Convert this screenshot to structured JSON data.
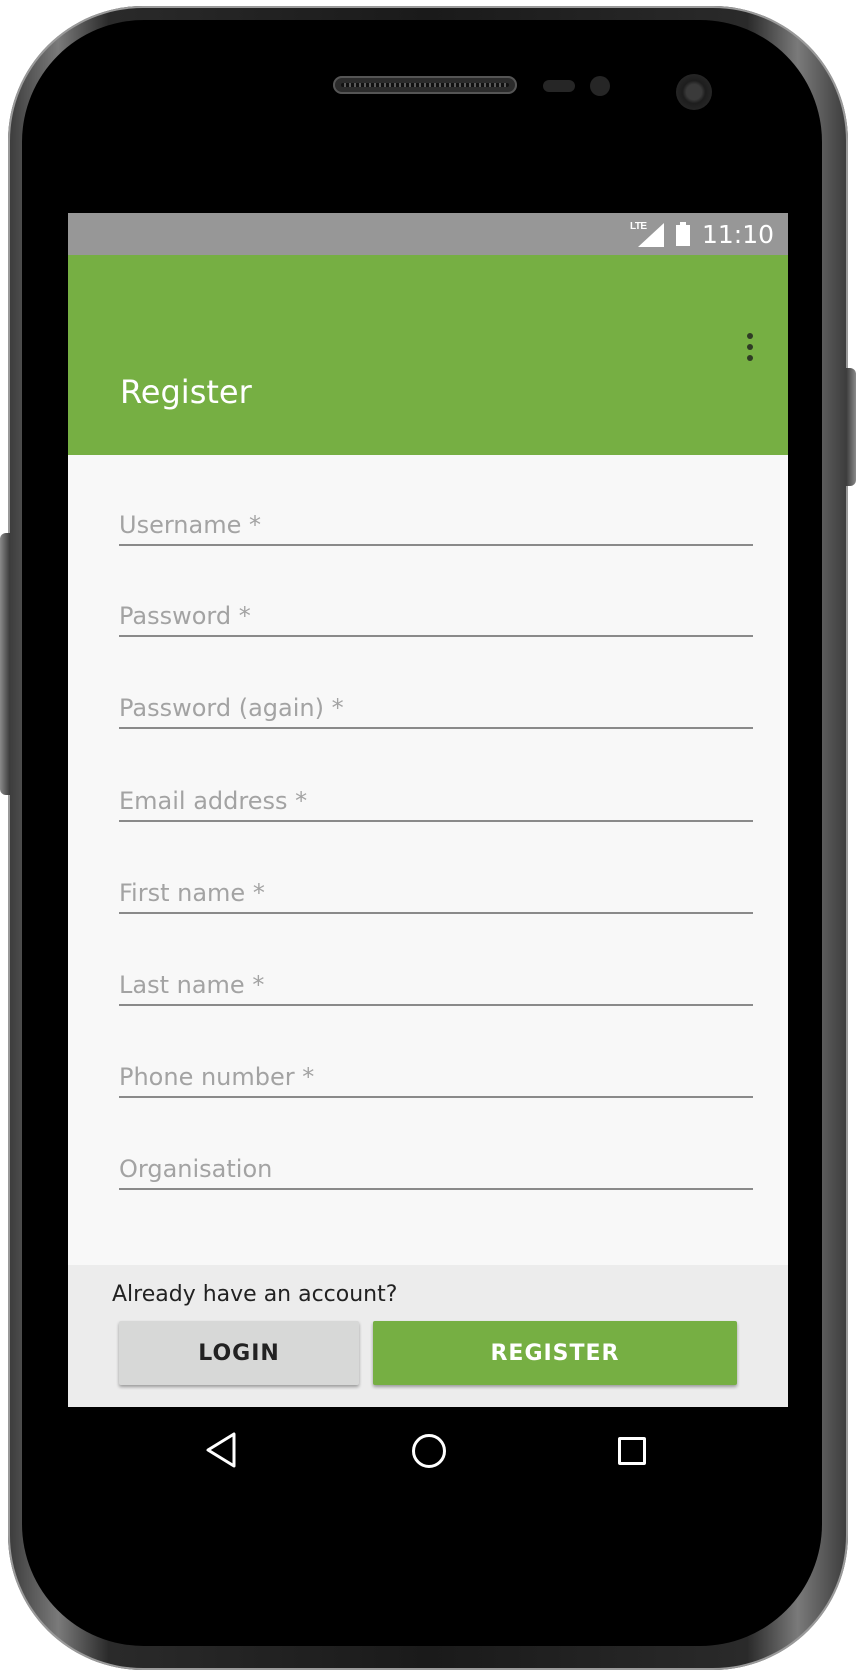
{
  "status_bar": {
    "network_label": "LTE",
    "time": "11:10"
  },
  "toolbar": {
    "title": "Register",
    "menu_icon": "overflow-menu-icon"
  },
  "form": {
    "fields": [
      {
        "name": "username",
        "placeholder": "Username *",
        "value": ""
      },
      {
        "name": "password",
        "placeholder": "Password *",
        "value": ""
      },
      {
        "name": "password_again",
        "placeholder": "Password (again) *",
        "value": ""
      },
      {
        "name": "email",
        "placeholder": "Email address *",
        "value": ""
      },
      {
        "name": "first_name",
        "placeholder": "First name *",
        "value": ""
      },
      {
        "name": "last_name",
        "placeholder": "Last name *",
        "value": ""
      },
      {
        "name": "phone",
        "placeholder": "Phone number *",
        "value": ""
      },
      {
        "name": "organisation",
        "placeholder": "Organisation",
        "value": ""
      }
    ]
  },
  "footer": {
    "prompt": "Already have an account?",
    "login_label": "LOGIN",
    "register_label": "REGISTER"
  },
  "nav_bar": {
    "icons": [
      "back-icon",
      "home-icon",
      "recents-icon"
    ]
  },
  "colors": {
    "accent": "#76af43",
    "status_bar": "#979797",
    "screen_background": "#f8f8f8",
    "footer_background": "#ececec",
    "login_button": "#d7d8d7"
  }
}
